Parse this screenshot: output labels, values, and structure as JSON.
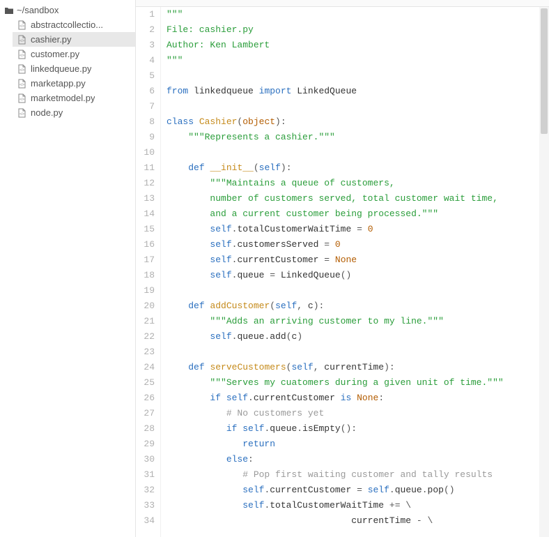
{
  "sidebar": {
    "root_label": "~/sandbox",
    "files": [
      {
        "label": "abstractcollectio...",
        "selected": false
      },
      {
        "label": "cashier.py",
        "selected": true
      },
      {
        "label": "customer.py",
        "selected": false
      },
      {
        "label": "linkedqueue.py",
        "selected": false
      },
      {
        "label": "marketapp.py",
        "selected": false
      },
      {
        "label": "marketmodel.py",
        "selected": false
      },
      {
        "label": "node.py",
        "selected": false
      }
    ]
  },
  "editor": {
    "line_start": 1,
    "line_end": 34,
    "lines": {
      "l1": [
        [
          "str",
          "\"\"\""
        ]
      ],
      "l2": [
        [
          "str",
          "File: cashier.py"
        ]
      ],
      "l3": [
        [
          "str",
          "Author: Ken Lambert"
        ]
      ],
      "l4": [
        [
          "str",
          "\"\"\""
        ]
      ],
      "l5": [],
      "l6": [
        [
          "kw",
          "from "
        ],
        [
          "id",
          "linkedqueue "
        ],
        [
          "kw",
          "import "
        ],
        [
          "id",
          "LinkedQueue"
        ]
      ],
      "l7": [],
      "l8": [
        [
          "kw",
          "class "
        ],
        [
          "def",
          "Cashier"
        ],
        [
          "punc",
          "("
        ],
        [
          "builtin",
          "object"
        ],
        [
          "punc",
          "):"
        ]
      ],
      "l9": [
        [
          "plain",
          "    "
        ],
        [
          "str",
          "\"\"\"Represents a cashier.\"\"\""
        ]
      ],
      "l10": [],
      "l11": [
        [
          "plain",
          "    "
        ],
        [
          "kw",
          "def "
        ],
        [
          "def",
          "__init__"
        ],
        [
          "punc",
          "("
        ],
        [
          "self",
          "self"
        ],
        [
          "punc",
          "):"
        ]
      ],
      "l12": [
        [
          "plain",
          "        "
        ],
        [
          "str",
          "\"\"\"Maintains a queue of customers,"
        ]
      ],
      "l13": [
        [
          "plain",
          "        "
        ],
        [
          "str",
          "number of customers served, total customer wait time,"
        ]
      ],
      "l14": [
        [
          "plain",
          "        "
        ],
        [
          "str",
          "and a current customer being processed.\"\"\""
        ]
      ],
      "l15": [
        [
          "plain",
          "        "
        ],
        [
          "self",
          "self"
        ],
        [
          "punc",
          "."
        ],
        [
          "id",
          "totalCustomerWaitTime "
        ],
        [
          "punc",
          "= "
        ],
        [
          "num",
          "0"
        ]
      ],
      "l16": [
        [
          "plain",
          "        "
        ],
        [
          "self",
          "self"
        ],
        [
          "punc",
          "."
        ],
        [
          "id",
          "customersServed "
        ],
        [
          "punc",
          "= "
        ],
        [
          "num",
          "0"
        ]
      ],
      "l17": [
        [
          "plain",
          "        "
        ],
        [
          "self",
          "self"
        ],
        [
          "punc",
          "."
        ],
        [
          "id",
          "currentCustomer "
        ],
        [
          "punc",
          "= "
        ],
        [
          "const",
          "None"
        ]
      ],
      "l18": [
        [
          "plain",
          "        "
        ],
        [
          "self",
          "self"
        ],
        [
          "punc",
          "."
        ],
        [
          "id",
          "queue "
        ],
        [
          "punc",
          "= "
        ],
        [
          "id",
          "LinkedQueue"
        ],
        [
          "punc",
          "()"
        ]
      ],
      "l19": [],
      "l20": [
        [
          "plain",
          "    "
        ],
        [
          "kw",
          "def "
        ],
        [
          "def",
          "addCustomer"
        ],
        [
          "punc",
          "("
        ],
        [
          "self",
          "self"
        ],
        [
          "punc",
          ", "
        ],
        [
          "id",
          "c"
        ],
        [
          "punc",
          "):"
        ]
      ],
      "l21": [
        [
          "plain",
          "        "
        ],
        [
          "str",
          "\"\"\"Adds an arriving customer to my line.\"\"\""
        ]
      ],
      "l22": [
        [
          "plain",
          "        "
        ],
        [
          "self",
          "self"
        ],
        [
          "punc",
          "."
        ],
        [
          "id",
          "queue"
        ],
        [
          "punc",
          "."
        ],
        [
          "id",
          "add"
        ],
        [
          "punc",
          "("
        ],
        [
          "id",
          "c"
        ],
        [
          "punc",
          ")"
        ]
      ],
      "l23": [],
      "l24": [
        [
          "plain",
          "    "
        ],
        [
          "kw",
          "def "
        ],
        [
          "def",
          "serveCustomers"
        ],
        [
          "punc",
          "("
        ],
        [
          "self",
          "self"
        ],
        [
          "punc",
          ", "
        ],
        [
          "id",
          "currentTime"
        ],
        [
          "punc",
          "):"
        ]
      ],
      "l25": [
        [
          "plain",
          "        "
        ],
        [
          "str",
          "\"\"\"Serves my cuatomers during a given unit of time.\"\"\""
        ]
      ],
      "l26": [
        [
          "plain",
          "        "
        ],
        [
          "kw",
          "if "
        ],
        [
          "self",
          "self"
        ],
        [
          "punc",
          "."
        ],
        [
          "id",
          "currentCustomer "
        ],
        [
          "kw",
          "is "
        ],
        [
          "const",
          "None"
        ],
        [
          "punc",
          ":"
        ]
      ],
      "l27": [
        [
          "plain",
          "           "
        ],
        [
          "cmt",
          "# No customers yet"
        ]
      ],
      "l28": [
        [
          "plain",
          "           "
        ],
        [
          "kw",
          "if "
        ],
        [
          "self",
          "self"
        ],
        [
          "punc",
          "."
        ],
        [
          "id",
          "queue"
        ],
        [
          "punc",
          "."
        ],
        [
          "id",
          "isEmpty"
        ],
        [
          "punc",
          "():"
        ]
      ],
      "l29": [
        [
          "plain",
          "              "
        ],
        [
          "kw",
          "return"
        ]
      ],
      "l30": [
        [
          "plain",
          "           "
        ],
        [
          "kw",
          "else"
        ],
        [
          "punc",
          ":"
        ]
      ],
      "l31": [
        [
          "plain",
          "              "
        ],
        [
          "cmt",
          "# Pop first waiting customer and tally results"
        ]
      ],
      "l32": [
        [
          "plain",
          "              "
        ],
        [
          "self",
          "self"
        ],
        [
          "punc",
          "."
        ],
        [
          "id",
          "currentCustomer "
        ],
        [
          "punc",
          "= "
        ],
        [
          "self",
          "self"
        ],
        [
          "punc",
          "."
        ],
        [
          "id",
          "queue"
        ],
        [
          "punc",
          "."
        ],
        [
          "id",
          "pop"
        ],
        [
          "punc",
          "()"
        ]
      ],
      "l33": [
        [
          "plain",
          "              "
        ],
        [
          "self",
          "self"
        ],
        [
          "punc",
          "."
        ],
        [
          "id",
          "totalCustomerWaitTime "
        ],
        [
          "punc",
          "+= "
        ],
        [
          "punc",
          "\\"
        ]
      ],
      "l34": [
        [
          "plain",
          "                                  "
        ],
        [
          "id",
          "currentTime "
        ],
        [
          "punc",
          "- "
        ],
        [
          "punc",
          "\\"
        ]
      ]
    }
  }
}
